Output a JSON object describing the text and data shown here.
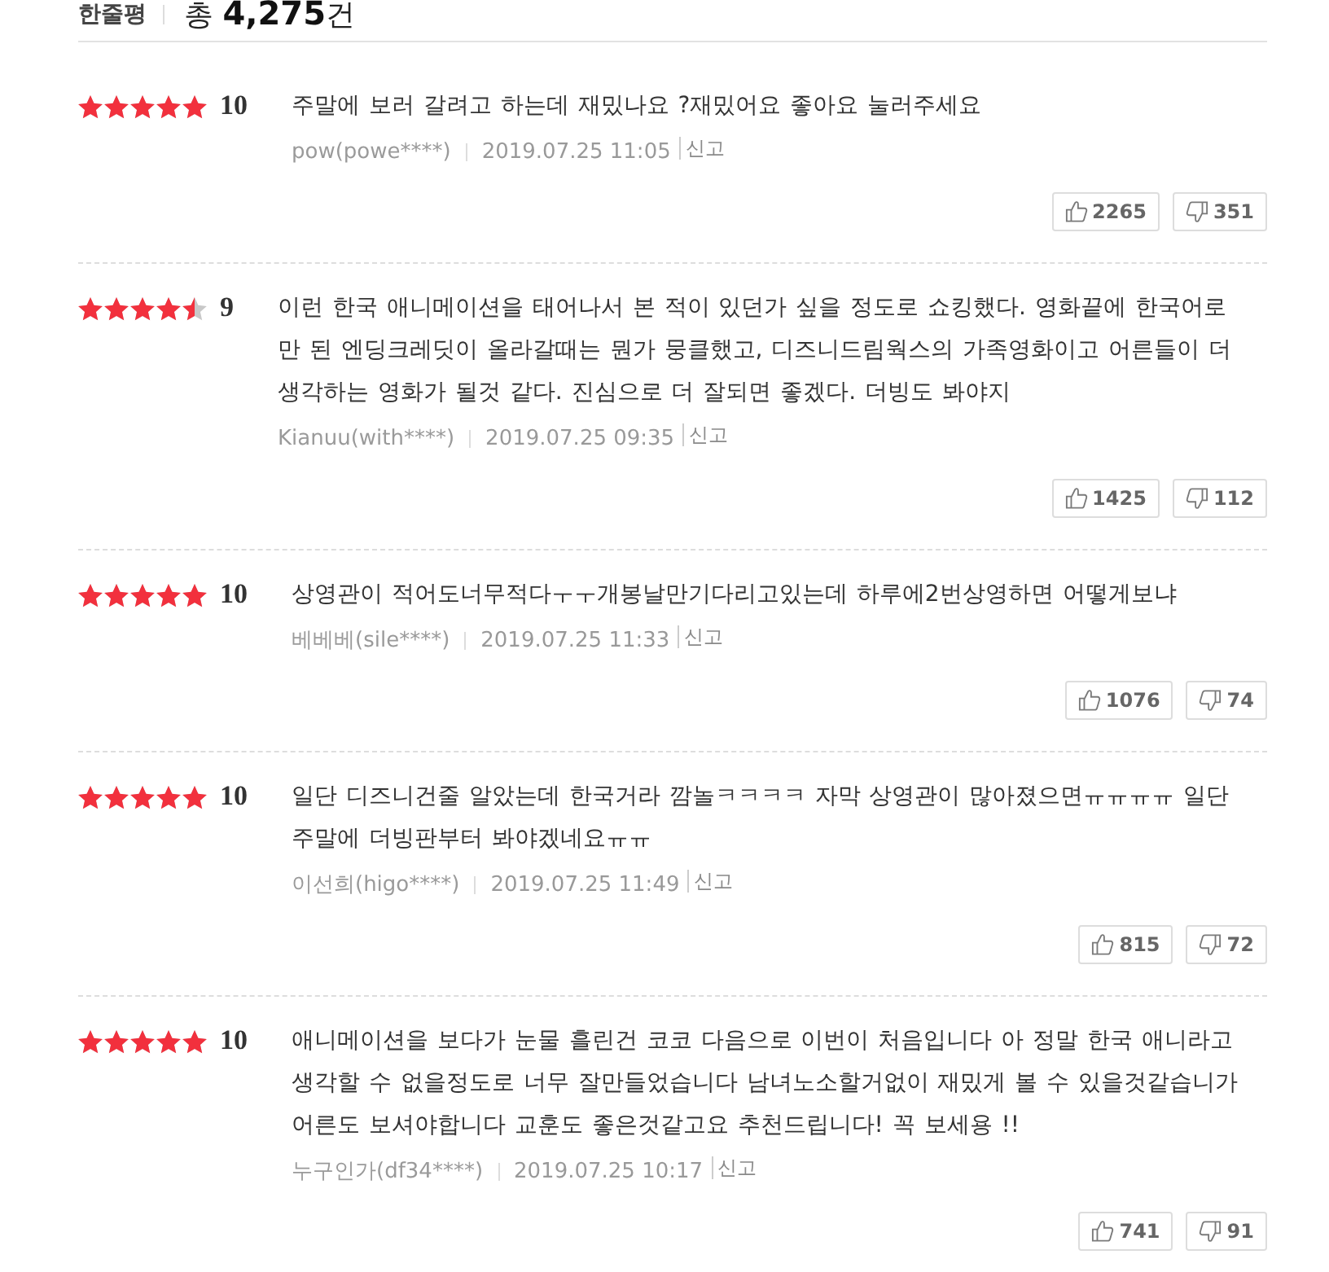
{
  "header": {
    "title": "한줄평",
    "total": "총 **4,275**건"
  },
  "reviews": [
    {
      "stars": 5,
      "score": "10",
      "text": "주말에 보러 갈려고 하는데 재밌나요 ?재밌어요 좋아요 눌러주세요",
      "author": "pow(powe****)",
      "date": "2019.07.25 11:05",
      "report": "신고",
      "likes": "2265",
      "dislikes": "351"
    },
    {
      "stars": 4.5,
      "score": "9",
      "text": "이런 한국 애니메이션을 태어나서 본 적이 있던가 싶을 정도로 쇼킹했다. 영화끝에 한국어로 만 된 엔딩크레딧이 올라갈때는 뭔가 뭉클했고, 디즈니드림웍스의 가족영화이고 어른들이 더 생각하는 영화가 될것 같다. 진심으로 더 잘되면 좋겠다. 더빙도 봐야지",
      "author": "Kianuu(with****)",
      "date": "2019.07.25 09:35",
      "report": "신고",
      "likes": "1425",
      "dislikes": "112"
    },
    {
      "stars": 5,
      "score": "10",
      "text": "상영관이 적어도너무적다ㅜㅜ개봉날만기다리고있는데 하루에2번상영하면 어떻게보냐",
      "author": "베베베(sile****)",
      "date": "2019.07.25 11:33",
      "report": "신고",
      "likes": "1076",
      "dislikes": "74"
    },
    {
      "stars": 5,
      "score": "10",
      "text": "일단 디즈니건줄 알았는데 한국거라 깜놀ㅋㅋㅋㅋ 자막 상영관이 많아졌으면ㅠㅠㅠㅠ 일단 주말에 더빙판부터 봐야겠네요ㅠㅠ",
      "author": "이선희(higo****)",
      "date": "2019.07.25 11:49",
      "report": "신고",
      "likes": "815",
      "dislikes": "72"
    },
    {
      "stars": 5,
      "score": "10",
      "text": "애니메이션을 보다가 눈물 흘린건 코코 다음으로 이번이 처음입니다 아 정말 한국 애니라고 생각할 수 없을정도로 너무 잘만들었습니다 남녀노소할거없이 재밌게 볼 수 있을것같습니가 어른도 보셔야합니다 교훈도 좋은것같고요 추천드립니다! 꼭 보세용 !!",
      "author": "누구인가(df34****)",
      "date": "2019.07.25 10:17",
      "report": "신고",
      "likes": "741",
      "dislikes": "91"
    }
  ]
}
